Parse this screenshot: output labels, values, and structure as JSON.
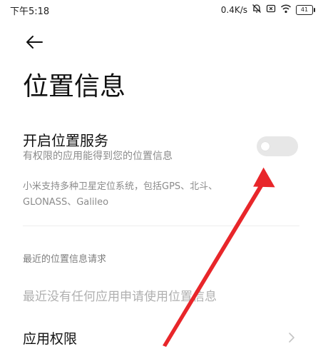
{
  "status_bar": {
    "time": "下午5:18",
    "net_speed": "0.4K/s",
    "battery": "41"
  },
  "page": {
    "title": "位置信息"
  },
  "location_service": {
    "title": "开启位置服务",
    "subtitle": "有权限的应用能得到您的位置信息",
    "enabled": false
  },
  "support_text": "小米支持多种卫星定位系统，包括GPS、北斗、GLONASS、Galileo",
  "recent": {
    "section_title": "最近的位置信息请求",
    "empty_text": "最近没有任何应用申请使用位置信息"
  },
  "app_permissions": {
    "label": "应用权限"
  },
  "colors": {
    "annotation_arrow": "#e8262a",
    "toggle_off": "#e7e7e7"
  }
}
